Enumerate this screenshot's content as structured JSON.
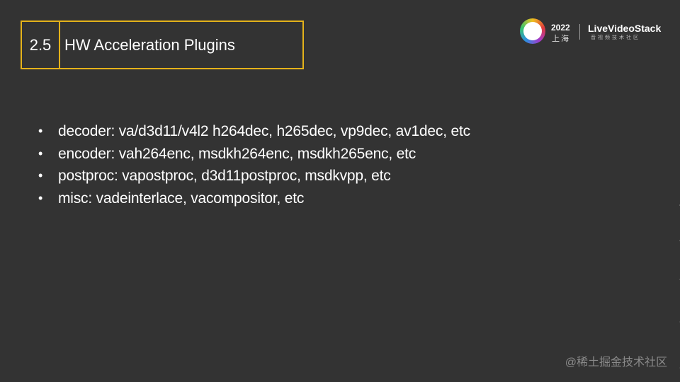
{
  "title": {
    "number": "2.5",
    "text": "HW Acceleration Plugins"
  },
  "logo": {
    "year": "2022",
    "city": "上海",
    "brand": "LiveVideoStack",
    "subtitle": "音视频技术社区"
  },
  "bullets": [
    "decoder: va/d3d11/v4l2 h264dec, h265dec, vp9dec, av1dec, etc",
    "encoder: vah264enc, msdkh264enc, msdkh265enc, etc",
    "postproc: vapostproc, d3d11postproc, msdkvpp, etc",
    "misc: vadeinterlace, vacompositor, etc"
  ],
  "bullet_symbol": "•",
  "watermark": "@稀土掘金技术社区",
  "colors": {
    "background": "#333333",
    "accent": "#e4b21a",
    "text": "#ffffff"
  }
}
